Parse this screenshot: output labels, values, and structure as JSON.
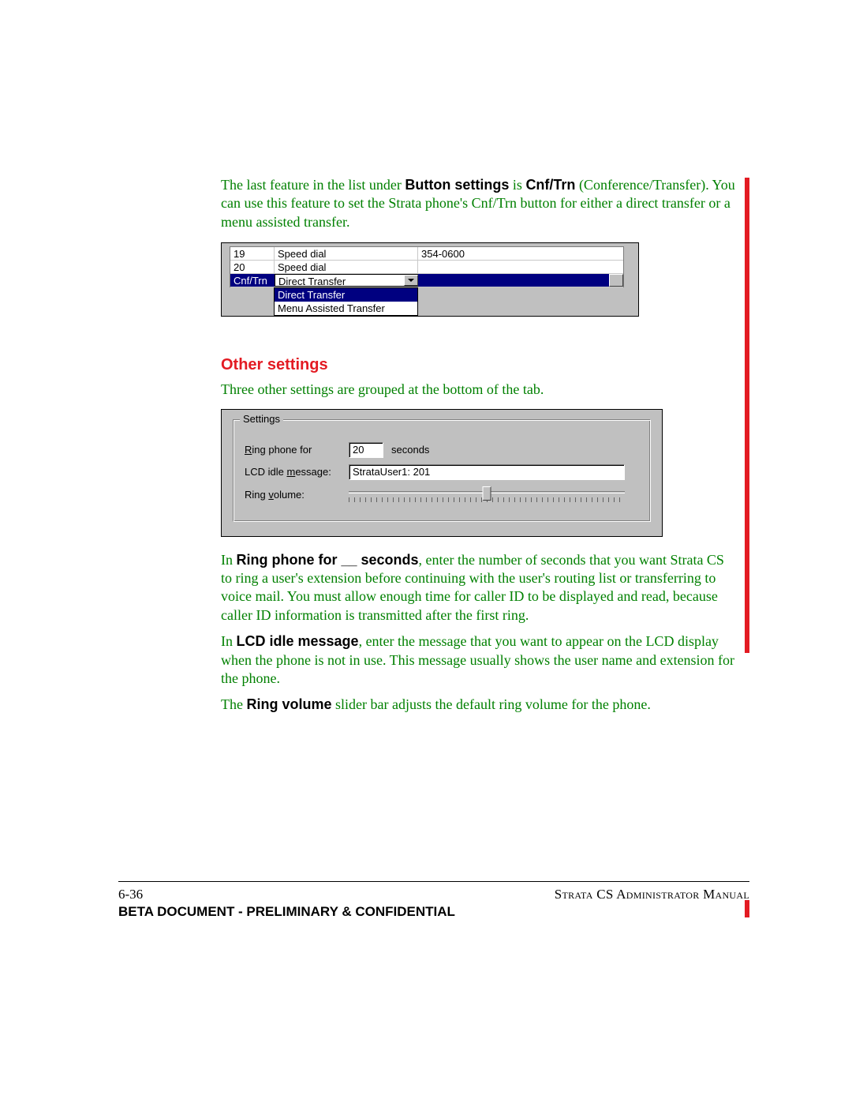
{
  "intro": {
    "p1_pre": "The last feature in the list under ",
    "bold1": "Button settings",
    "p1_mid": " is ",
    "bold2": "Cnf/Trn",
    "p1_post": " (Conference/Transfer). You can use this feature to set the Strata phone's Cnf/Trn button for either a direct transfer or a menu assisted transfer."
  },
  "fig1": {
    "rows": [
      {
        "key": "19",
        "type": "Speed dial",
        "val": "354-0600"
      },
      {
        "key": "20",
        "type": "Speed dial",
        "val": ""
      },
      {
        "key": "Cnf/Trn",
        "type": "Direct Transfer",
        "val": ""
      }
    ],
    "dropdown": [
      "Direct Transfer",
      "Menu Assisted Transfer"
    ]
  },
  "section_heading": "Other settings",
  "section_intro": "Three other settings are grouped at the bottom of the tab.",
  "fig2": {
    "legend": "Settings",
    "ring_label": "Ring phone for",
    "ring_value": "20",
    "ring_after": "seconds",
    "lcd_label": "LCD idle message:",
    "lcd_value": "StrataUser1: 201",
    "vol_label": "Ring volume:"
  },
  "para_ring": {
    "pre": "In ",
    "bold": "Ring phone for __ seconds",
    "post": ", enter the number of seconds that you want Strata CS to ring a user's extension before continuing with the user's routing list or transferring to voice mail. You must allow enough time for caller ID to be displayed and read, because caller ID information is transmitted after the first ring."
  },
  "para_lcd": {
    "pre": "In ",
    "bold": "LCD idle message",
    "post": ", enter the message that you want to appear on the LCD display when the phone is not in use. This message usually shows the user name and extension for the phone."
  },
  "para_vol": {
    "pre": "The ",
    "bold": "Ring volume",
    "post": " slider bar adjusts the default ring volume for the phone."
  },
  "footer": {
    "page": "6-36",
    "manual_pre": "S",
    "manual": "trata CS Administrator Manual",
    "confidential": "BETA DOCUMENT - PRELIMINARY & CONFIDENTIAL"
  }
}
